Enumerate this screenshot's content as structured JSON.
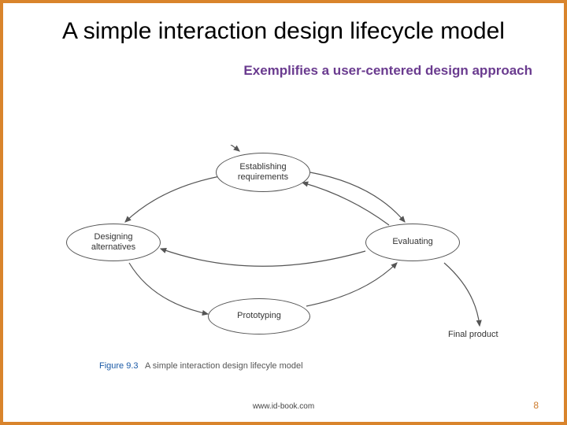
{
  "title": "A simple interaction design lifecycle model",
  "subtitle": "Exemplifies a user-centered design approach",
  "diagram": {
    "nodes": {
      "requirements": "Establishing\nrequirements",
      "designing": "Designing\nalternatives",
      "evaluating": "Evaluating",
      "prototyping": "Prototyping"
    },
    "final_label": "Final product"
  },
  "figure": {
    "number": "Figure 9.3",
    "caption": "A simple interaction design lifecyle model"
  },
  "footer": {
    "url": "www.id-book.com",
    "page": "8"
  }
}
